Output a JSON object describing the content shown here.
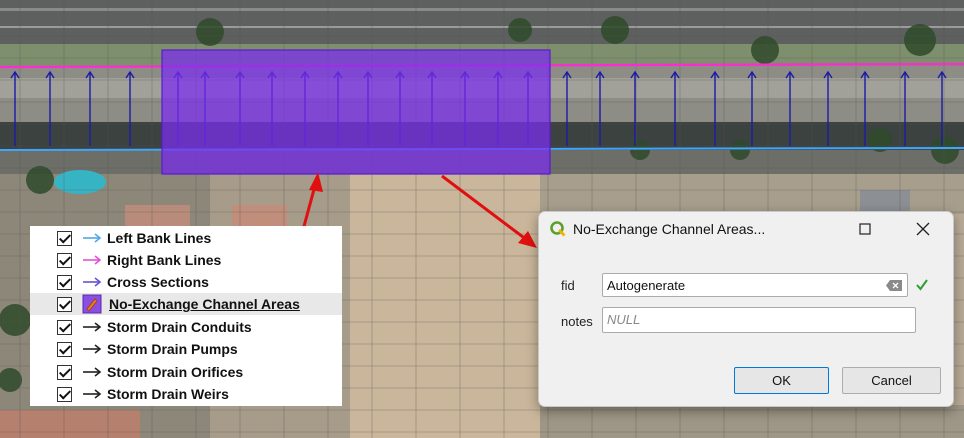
{
  "layers_panel": {
    "items": [
      {
        "label": "Left Bank Lines",
        "checked": true,
        "symbol": "arrow-line-icon",
        "color": "#4fa9e6"
      },
      {
        "label": "Right Bank Lines",
        "checked": true,
        "symbol": "arrow-line-icon",
        "color": "#e84fd8"
      },
      {
        "label": "Cross Sections",
        "checked": true,
        "symbol": "arrow-line-icon",
        "color": "#6b4fd8"
      },
      {
        "label": "No-Exchange Channel Areas",
        "checked": true,
        "symbol": "polygon-edit-icon",
        "color": "#8a4fe0",
        "selected": true
      },
      {
        "label": "Storm Drain Conduits",
        "checked": true,
        "symbol": "arrow-line-icon",
        "color": "#222222"
      },
      {
        "label": "Storm Drain Pumps",
        "checked": true,
        "symbol": "arrow-line-icon",
        "color": "#222222"
      },
      {
        "label": "Storm Drain Orifices",
        "checked": true,
        "symbol": "arrow-line-icon",
        "color": "#222222"
      },
      {
        "label": "Storm Drain Weirs",
        "checked": true,
        "symbol": "arrow-line-icon",
        "color": "#222222"
      }
    ]
  },
  "dialog": {
    "title": "No-Exchange Channel Areas...",
    "fields": {
      "fid_label": "fid",
      "fid_value": "Autogenerate",
      "notes_label": "notes",
      "notes_placeholder": "NULL"
    },
    "ok_label": "OK",
    "cancel_label": "Cancel"
  },
  "colors": {
    "polygon_fill": "#7b2cf0",
    "right_bank": "#ff2ad4",
    "left_bank": "#3fa6ff",
    "cross_section": "#1a1aa8",
    "annotation_arrow": "#e01010",
    "valid_check": "#2e9e2e"
  }
}
